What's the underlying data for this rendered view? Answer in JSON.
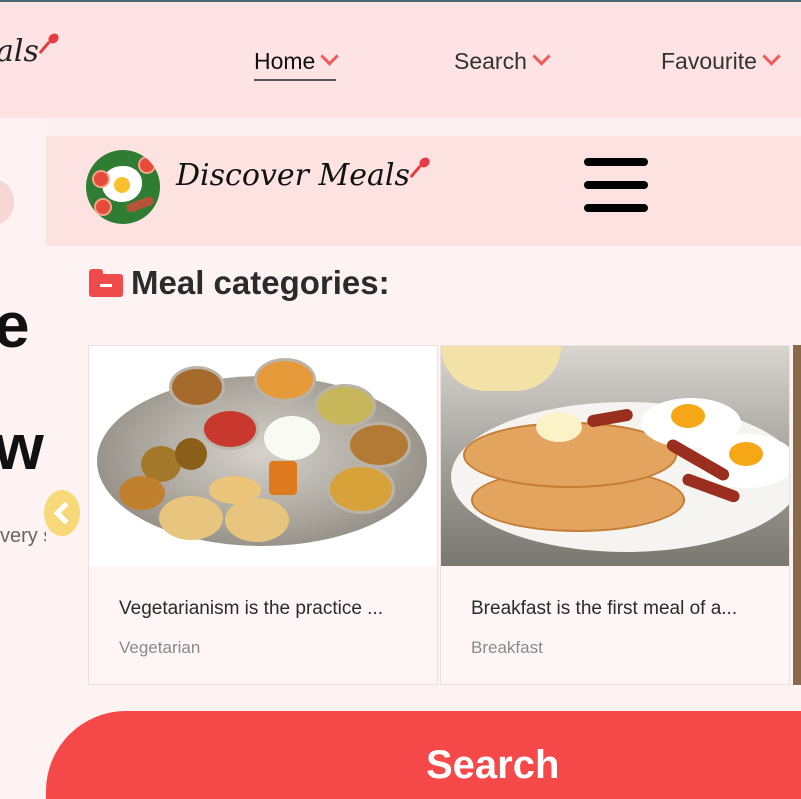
{
  "brand": {
    "name": "Discover Meals"
  },
  "bg_nav": {
    "logo_fragment": "als",
    "items": [
      {
        "label": "Home",
        "active": true
      },
      {
        "label": "Search",
        "active": false
      },
      {
        "label": "Favourite",
        "active": false
      }
    ]
  },
  "bg_hero": {
    "line1": "e",
    "line2": "wit",
    "line3": "very s"
  },
  "section": {
    "title": "Meal categories:"
  },
  "cards": [
    {
      "description": "Vegetarianism is the practice ...",
      "category": "Vegetarian"
    },
    {
      "description": "Breakfast is the first meal of a...",
      "category": "Breakfast"
    }
  ],
  "search": {
    "label": "Search"
  },
  "colors": {
    "accent": "#f54848",
    "header_bg": "#fde2e2",
    "page_bg": "#fdf3f3",
    "slider_arrow": "#f7d97a"
  },
  "icons": [
    "spoon-icon",
    "chevron-down-icon",
    "menu-icon",
    "folder-minus-icon",
    "chevron-left-icon"
  ]
}
